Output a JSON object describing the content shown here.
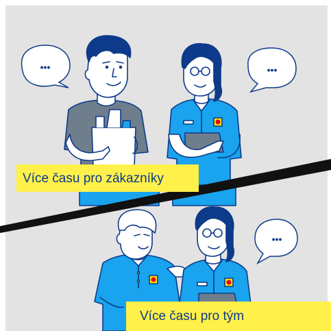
{
  "speech_bubble_text": "•••",
  "captions": {
    "customers": "Více času pro zákazníky",
    "team": "Více času pro tým"
  },
  "colors": {
    "background": "#e3e3e3",
    "frame": "#ffffff",
    "outline": "#0d3a8a",
    "uniform_blue": "#1aa3ee",
    "skin": "#ffffff",
    "hair": "#0d3a8a",
    "shirt_grey": "#6f7e8c",
    "bag": "#ffffff",
    "clipboard": "#6f7e8c",
    "banner_yellow": "#fff04a",
    "divider": "#111111",
    "logo_yellow": "#ffe400",
    "logo_red": "#e3001b"
  }
}
